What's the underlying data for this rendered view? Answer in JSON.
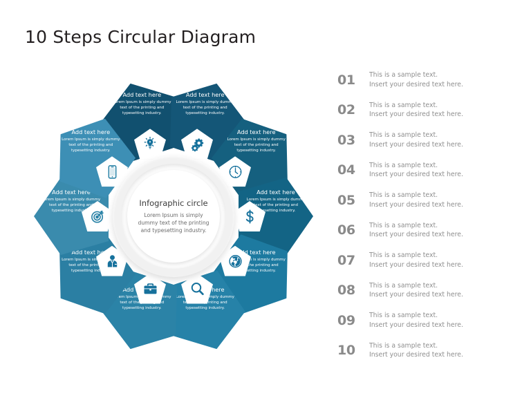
{
  "page": {
    "title": "10 Steps Circular Diagram"
  },
  "center": {
    "title": "Infographic circle",
    "body": "Lorem Ipsum is simply dummy text of the printing and typesetting industry."
  },
  "petals": [
    {
      "index": 1,
      "icon": "lightbulb-icon",
      "heading": "Add text here",
      "body": "Lorem Ipsum is simply dummy text of the printing and typesetting industry.",
      "color": "#11506f",
      "angle": -18
    },
    {
      "index": 2,
      "icon": "gears-icon",
      "heading": "Add text here",
      "body": "Lorem Ipsum is simply dummy text of the printing and typesetting industry.",
      "color": "#145677",
      "angle": 18
    },
    {
      "index": 3,
      "icon": "clock-icon",
      "heading": "Add text here",
      "body": "Lorem Ipsum is simply dummy text of the printing and typesetting industry.",
      "color": "#15607f",
      "angle": 54
    },
    {
      "index": 4,
      "icon": "dollar-icon",
      "heading": "Add text here",
      "body": "Lorem Ipsum is simply dummy text of the printing and typesetting industry.",
      "color": "#136485",
      "angle": 90
    },
    {
      "index": 5,
      "icon": "globe-icon",
      "heading": "Add text here",
      "body": "Lorem Ipsum is simply dummy text of the printing and typesetting industry.",
      "color": "#1d7aa0",
      "angle": 126
    },
    {
      "index": 6,
      "icon": "magnifier-icon",
      "heading": "Add text here",
      "body": "Lorem Ipsum is simply dummy text of the printing and typesetting industry.",
      "color": "#2682a8",
      "angle": 162
    },
    {
      "index": 7,
      "icon": "briefcase-icon",
      "heading": "Add text here",
      "body": "Lorem Ipsum is simply dummy text of the printing and typesetting industry.",
      "color": "#2b83a7",
      "angle": 198
    },
    {
      "index": 8,
      "icon": "businessperson-icon",
      "heading": "Add text here",
      "body": "Lorem Ipsum is simply dummy text of the printing and typesetting industry.",
      "color": "#2b7fa3",
      "angle": 234
    },
    {
      "index": 9,
      "icon": "target-icon",
      "heading": "Add text here",
      "body": "Lorem Ipsum is simply dummy text of the printing and typesetting industry.",
      "color": "#3a8bad",
      "angle": 270
    },
    {
      "index": 10,
      "icon": "mobile-icon",
      "heading": "Add text here",
      "body": "Lorem Ipsum is simply dummy text of the printing and typesetting industry.",
      "color": "#3d8fb5",
      "angle": 306
    }
  ],
  "list": {
    "items": [
      {
        "number": "01",
        "line1": "This is a sample text.",
        "line2": "Insert your desired text here."
      },
      {
        "number": "02",
        "line1": "This is a sample text.",
        "line2": "Insert your desired text here."
      },
      {
        "number": "03",
        "line1": "This is a sample text.",
        "line2": "Insert your desired text here."
      },
      {
        "number": "04",
        "line1": "This is a sample text.",
        "line2": "Insert your desired text here."
      },
      {
        "number": "05",
        "line1": "This is a sample text.",
        "line2": "Insert your desired text here."
      },
      {
        "number": "06",
        "line1": "This is a sample text.",
        "line2": "Insert your desired text here."
      },
      {
        "number": "07",
        "line1": "This is a sample text.",
        "line2": "Insert your desired text here."
      },
      {
        "number": "08",
        "line1": "This is a sample text.",
        "line2": "Insert your desired text here."
      },
      {
        "number": "09",
        "line1": "This is a sample text.",
        "line2": "Insert your desired text here."
      },
      {
        "number": "10",
        "line1": "This is a sample text.",
        "line2": "Insert your desired text here."
      }
    ],
    "number_color": "#8a8a8a",
    "text_color": "#8f8f8f"
  }
}
